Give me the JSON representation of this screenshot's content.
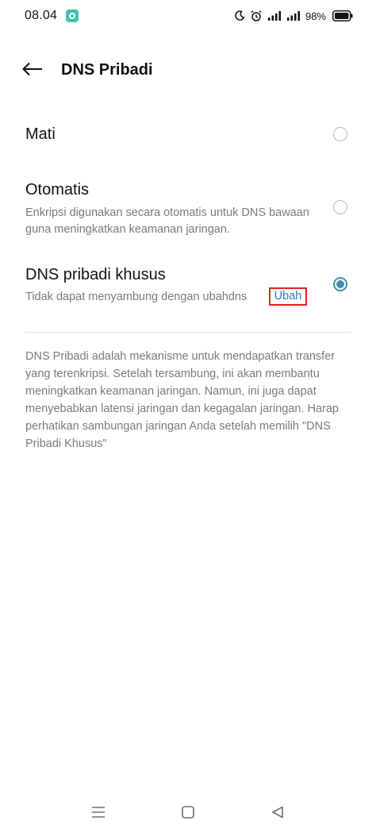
{
  "status_bar": {
    "time": "08.04",
    "battery_percent": "98%",
    "icons": [
      "chat-app-icon",
      "moon-icon",
      "alarm-icon",
      "signal-icon",
      "signal-icon",
      "battery-icon"
    ]
  },
  "header": {
    "title": "DNS Pribadi",
    "back_icon": "arrow-left-icon"
  },
  "options": [
    {
      "title": "Mati",
      "description": "",
      "selected": false
    },
    {
      "title": "Otomatis",
      "description": "Enkripsi digunakan secara otomatis untuk DNS bawaan guna meningkatkan keamanan jaringan.",
      "selected": false
    },
    {
      "title": "DNS pribadi khusus",
      "description": "Tidak dapat menyambung dengan ubahdns",
      "action_label": "Ubah",
      "selected": true
    }
  ],
  "info_text": "DNS Pribadi adalah mekanisme untuk mendapatkan transfer yang terenkripsi. Setelah tersambung, ini akan membantu meningkatkan keamanan jaringan. Namun, ini juga dapat menyebabkan latensi jaringan dan kegagalan jaringan. Harap perhatikan sambungan jaringan Anda setelah memilih \"DNS Pribadi Khusus\"",
  "nav_bar": {
    "icons": [
      "menu-icon",
      "home-square-icon",
      "back-triangle-icon"
    ]
  },
  "colors": {
    "accent": "#3f8fae",
    "link": "#2979c9",
    "highlight_border": "#e02020",
    "secondary_text": "#7a7a7a"
  }
}
